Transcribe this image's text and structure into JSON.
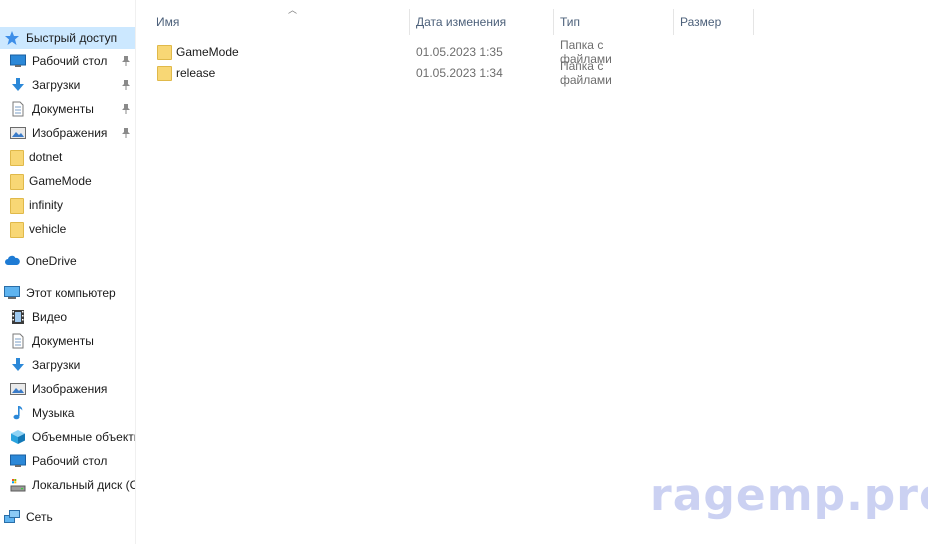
{
  "sidebar": {
    "quick_access": "Быстрый доступ",
    "quick_items": [
      {
        "label": "Рабочий стол",
        "icon": "desktop-icon",
        "pinned": true
      },
      {
        "label": "Загрузки",
        "icon": "downloads-icon",
        "pinned": true
      },
      {
        "label": "Документы",
        "icon": "documents-icon",
        "pinned": true
      },
      {
        "label": "Изображения",
        "icon": "pictures-icon",
        "pinned": true
      },
      {
        "label": "dotnet",
        "icon": "folder-icon",
        "pinned": false
      },
      {
        "label": "GameMode",
        "icon": "folder-icon",
        "pinned": false
      },
      {
        "label": "infinity",
        "icon": "folder-icon",
        "pinned": false
      },
      {
        "label": "vehicle",
        "icon": "folder-icon",
        "pinned": false
      }
    ],
    "onedrive": "OneDrive",
    "this_pc": "Этот компьютер",
    "pc_items": [
      {
        "label": "Видео",
        "icon": "video-icon"
      },
      {
        "label": "Документы",
        "icon": "documents-icon"
      },
      {
        "label": "Загрузки",
        "icon": "downloads-icon"
      },
      {
        "label": "Изображения",
        "icon": "pictures-icon"
      },
      {
        "label": "Музыка",
        "icon": "music-icon"
      },
      {
        "label": "Объемные объекты",
        "icon": "3d-objects-icon"
      },
      {
        "label": "Рабочий стол",
        "icon": "desktop-icon"
      },
      {
        "label": "Локальный диск (C:)",
        "icon": "drive-icon"
      }
    ],
    "network": "Сеть"
  },
  "columns": {
    "name": "Имя",
    "date": "Дата изменения",
    "type": "Тип",
    "size": "Размер"
  },
  "files": [
    {
      "name": "GameMode",
      "date": "01.05.2023 1:35",
      "type": "Папка с файлами"
    },
    {
      "name": "release",
      "date": "01.05.2023 1:34",
      "type": "Папка с файлами"
    }
  ],
  "watermark": "ragemp.pro",
  "colors": {
    "selected": "#cce8ff",
    "folder": "#f8d775",
    "header_text": "#4c607a"
  }
}
